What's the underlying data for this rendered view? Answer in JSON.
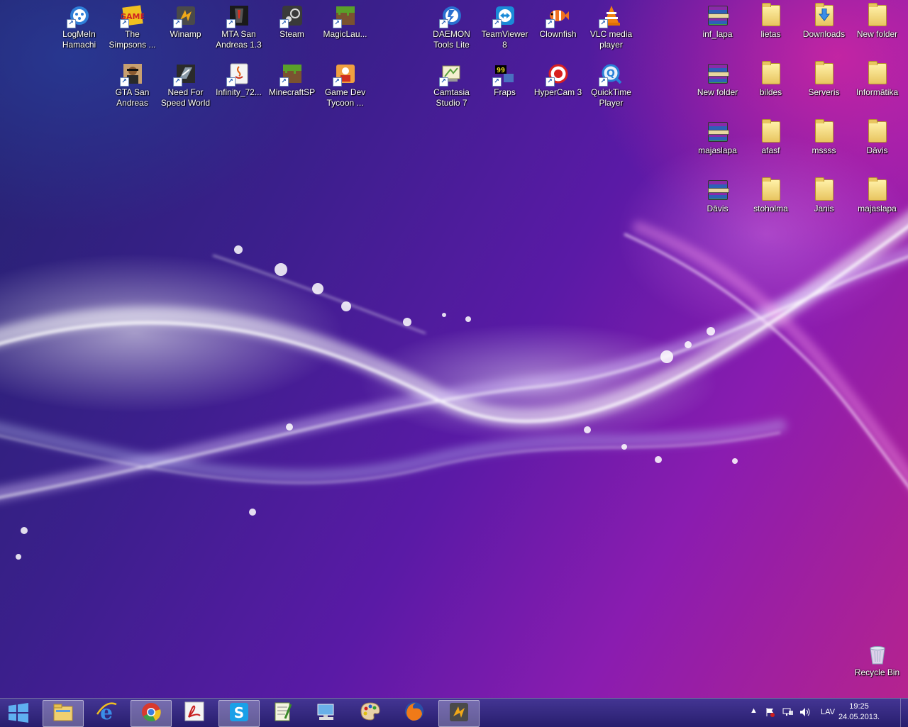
{
  "desktop_icons_left": [
    {
      "label": "LogMeIn\nHamachi",
      "icon": "hamachi-icon",
      "color": "#2f7fd8"
    },
    {
      "label": "The\nSimpsons ...",
      "icon": "simpsons-game-icon",
      "color": "#f0c020"
    },
    {
      "label": "Winamp",
      "icon": "winamp-icon",
      "color": "#e0a020"
    },
    {
      "label": "MTA San\nAndreas 1.3",
      "icon": "mta-icon",
      "color": "#222222"
    },
    {
      "label": "Steam",
      "icon": "steam-icon",
      "color": "#444444"
    },
    {
      "label": "MagicLau...",
      "icon": "minecraft-grass-icon",
      "color": "#5a8a2a"
    },
    {
      "label": "GTA San\nAndreas",
      "icon": "gta-icon",
      "color": "#b06a30"
    },
    {
      "label": "Need For\nSpeed World",
      "icon": "nfs-icon",
      "color": "#333333"
    },
    {
      "label": "Infinity_72...",
      "icon": "java-icon",
      "color": "#e8e8e8"
    },
    {
      "label": "MinecraftSP",
      "icon": "minecraft-grass-icon",
      "color": "#5a8a2a"
    },
    {
      "label": "Game Dev\nTycoon ...",
      "icon": "game-dev-tycoon-icon",
      "color": "#e07030"
    }
  ],
  "desktop_icons_middle": [
    {
      "label": "DAEMON\nTools Lite",
      "icon": "daemon-tools-icon",
      "color": "#2a70d0"
    },
    {
      "label": "TeamViewer\n8",
      "icon": "teamviewer-icon",
      "color": "#1a8ad8"
    },
    {
      "label": "Clownfish",
      "icon": "clownfish-icon",
      "color": "#f07020"
    },
    {
      "label": "VLC media\nplayer",
      "icon": "vlc-cone-icon",
      "color": "#f08010"
    },
    {
      "label": "Camtasia\nStudio 7",
      "icon": "camtasia-icon",
      "color": "#5aa040"
    },
    {
      "label": "Fraps",
      "icon": "fraps-icon",
      "color": "#e8e020"
    },
    {
      "label": "HyperCam 3",
      "icon": "hypercam-icon",
      "color": "#d82020"
    },
    {
      "label": "QuickTime\nPlayer",
      "icon": "quicktime-icon",
      "color": "#2a80d8"
    }
  ],
  "desktop_icons_right": [
    {
      "label": "inf_lapa",
      "type": "archive"
    },
    {
      "label": "lietas",
      "type": "folder"
    },
    {
      "label": "Downloads",
      "type": "folder-download"
    },
    {
      "label": "New folder",
      "type": "folder"
    },
    {
      "label": "New folder",
      "type": "archive"
    },
    {
      "label": "bildes",
      "type": "folder"
    },
    {
      "label": "Serveris",
      "type": "folder"
    },
    {
      "label": "Informātika",
      "type": "folder"
    },
    {
      "label": "majaslapa",
      "type": "archive"
    },
    {
      "label": "afasf",
      "type": "folder"
    },
    {
      "label": "mssss",
      "type": "folder"
    },
    {
      "label": "Dāvis",
      "type": "folder"
    },
    {
      "label": "Dāvis",
      "type": "archive"
    },
    {
      "label": "stoholma",
      "type": "folder"
    },
    {
      "label": "Janis",
      "type": "folder"
    },
    {
      "label": "majaslapa",
      "type": "folder"
    }
  ],
  "recycle_bin": {
    "label": "Recycle Bin"
  },
  "taskbar": {
    "start_icon": "windows-logo-icon",
    "pinned": [
      {
        "name": "file-explorer",
        "icon": "folder-explorer-icon",
        "active": true
      },
      {
        "name": "internet-explorer",
        "icon": "ie-icon",
        "active": false
      },
      {
        "name": "chrome",
        "icon": "chrome-icon",
        "active": true
      },
      {
        "name": "acrobat",
        "icon": "acrobat-icon",
        "active": false
      },
      {
        "name": "skype",
        "icon": "skype-icon",
        "active": true
      },
      {
        "name": "notepad-plus",
        "icon": "notepad-plus-icon",
        "active": false
      },
      {
        "name": "remote-desktop",
        "icon": "remote-desktop-icon",
        "active": false
      },
      {
        "name": "paint",
        "icon": "paint-palette-icon",
        "active": false
      },
      {
        "name": "firefox",
        "icon": "firefox-icon",
        "active": false
      },
      {
        "name": "winamp",
        "icon": "winamp-icon",
        "active": true
      }
    ],
    "tray": {
      "language": "LAV",
      "time": "19:25",
      "date": "24.05.2013."
    }
  }
}
